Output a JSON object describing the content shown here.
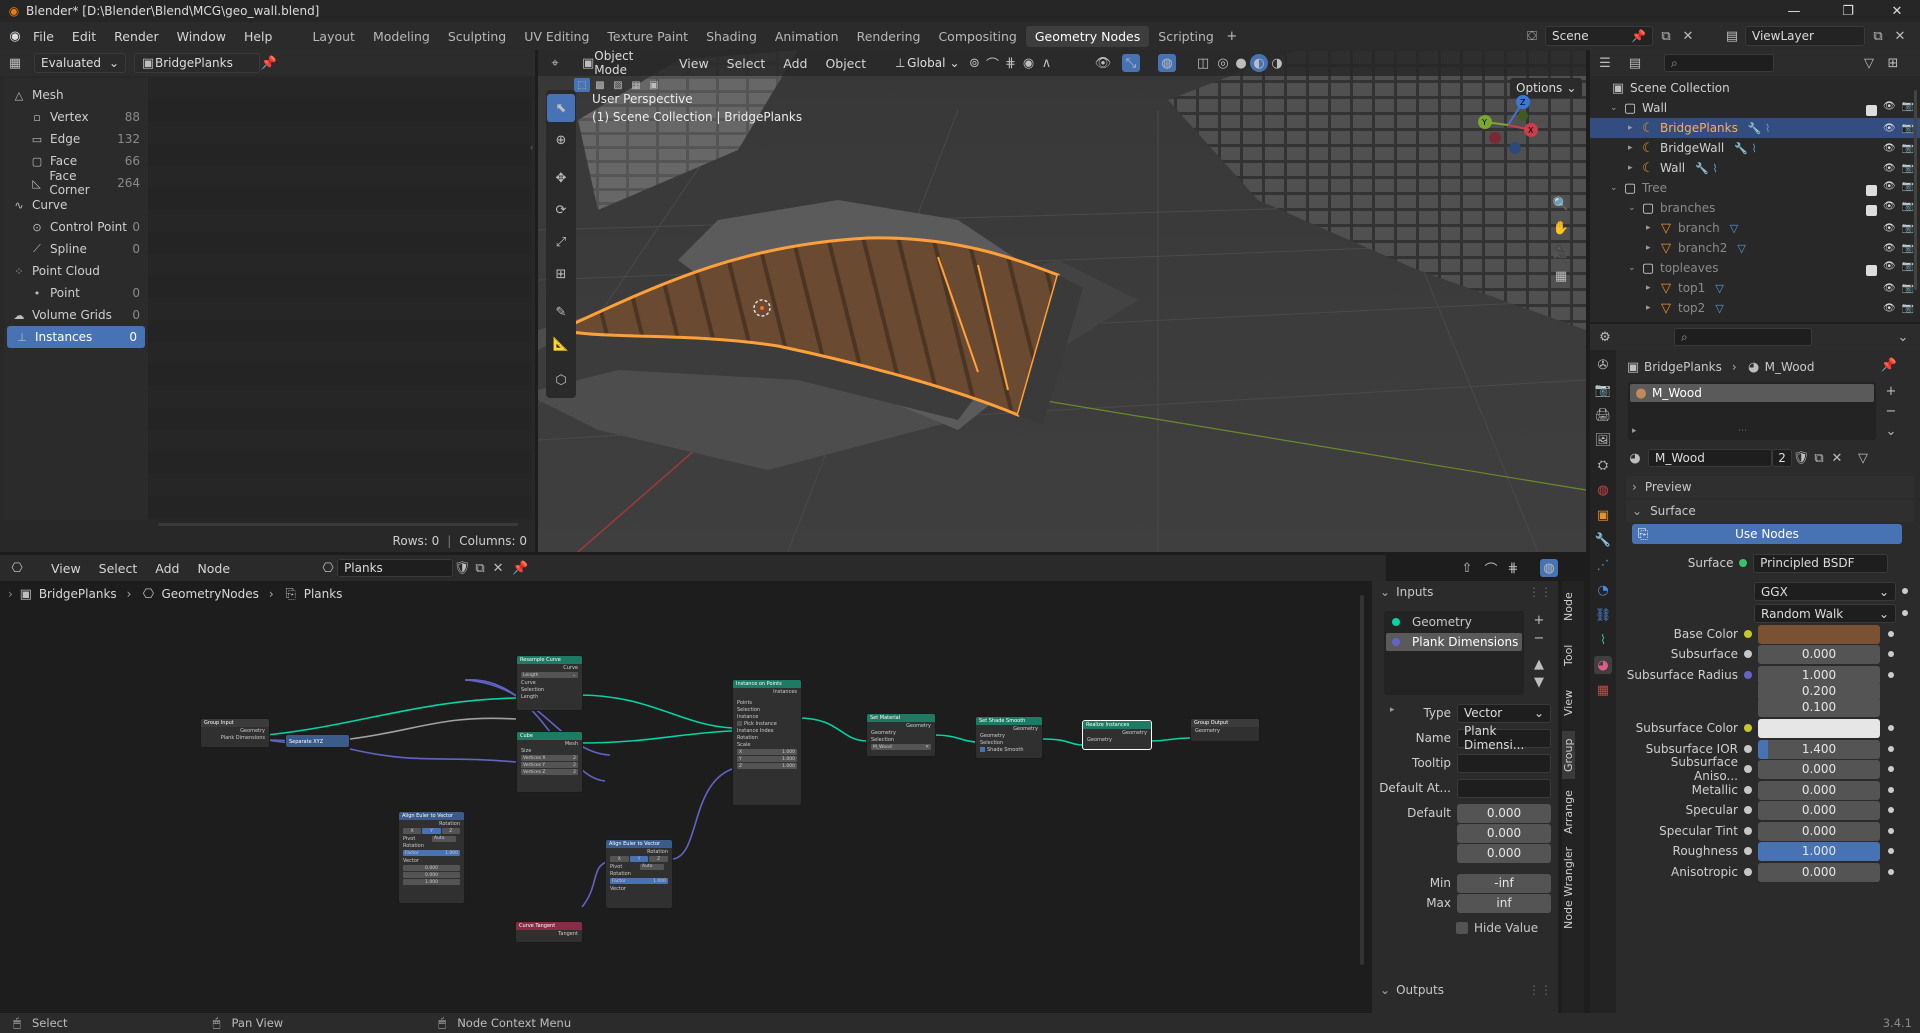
{
  "titlebar": {
    "title": "Blender* [D:\\Blender\\Blend\\MCG\\geo_wall.blend]"
  },
  "menu": [
    "File",
    "Edit",
    "Render",
    "Window",
    "Help"
  ],
  "workspaces": [
    "Layout",
    "Modeling",
    "Sculpting",
    "UV Editing",
    "Texture Paint",
    "Shading",
    "Animation",
    "Rendering",
    "Compositing",
    "Geometry Nodes",
    "Scripting"
  ],
  "active_workspace": "Geometry Nodes",
  "scene": {
    "name": "Scene",
    "view_layer": "ViewLayer"
  },
  "spreadsheet": {
    "mode": "Evaluated",
    "object": "BridgePlanks",
    "rows_label": "Rows: 0",
    "columns_label": "Columns: 0",
    "items": [
      {
        "label": "Mesh",
        "value": "",
        "level": 0
      },
      {
        "label": "Vertex",
        "value": "88",
        "level": 1
      },
      {
        "label": "Edge",
        "value": "132",
        "level": 1
      },
      {
        "label": "Face",
        "value": "66",
        "level": 1
      },
      {
        "label": "Face Corner",
        "value": "264",
        "level": 1
      },
      {
        "label": "Curve",
        "value": "",
        "level": 0
      },
      {
        "label": "Control Point",
        "value": "0",
        "level": 1
      },
      {
        "label": "Spline",
        "value": "0",
        "level": 1
      },
      {
        "label": "Point Cloud",
        "value": "",
        "level": 0
      },
      {
        "label": "Point",
        "value": "0",
        "level": 1
      },
      {
        "label": "Volume Grids",
        "value": "0",
        "level": 0
      },
      {
        "label": "Instances",
        "value": "0",
        "level": 0,
        "active": true
      }
    ]
  },
  "viewport": {
    "mode": "Object Mode",
    "menus": [
      "View",
      "Select",
      "Add",
      "Object"
    ],
    "transform": "Global",
    "options": "Options",
    "perspective": "User Perspective",
    "collection_line": "(1) Scene Collection | BridgePlanks"
  },
  "outliner": {
    "root": "Scene Collection",
    "rows": [
      {
        "label": "Wall",
        "level": 0,
        "type": "collection"
      },
      {
        "label": "BridgePlanks",
        "level": 1,
        "type": "object",
        "selected": true
      },
      {
        "label": "BridgeWall",
        "level": 1,
        "type": "object"
      },
      {
        "label": "Wall",
        "level": 1,
        "type": "object"
      },
      {
        "label": "Tree",
        "level": 0,
        "type": "collection",
        "dim": true
      },
      {
        "label": "branches",
        "level": 1,
        "type": "collection",
        "dim": true
      },
      {
        "label": "branch",
        "level": 2,
        "type": "object",
        "dim": true
      },
      {
        "label": "branch2",
        "level": 2,
        "type": "object",
        "dim": true
      },
      {
        "label": "topleaves",
        "level": 1,
        "type": "collection",
        "dim": true
      },
      {
        "label": "top1",
        "level": 2,
        "type": "object",
        "dim": true
      },
      {
        "label": "top2",
        "level": 2,
        "type": "object",
        "dim": true
      }
    ]
  },
  "properties": {
    "breadcrumb_object": "BridgePlanks",
    "breadcrumb_material": "M_Wood",
    "slot": "M_Wood",
    "material_name": "M_Wood",
    "users": "2",
    "preview_label": "Preview",
    "surface_panel": "Surface",
    "use_nodes": "Use Nodes",
    "surface_label": "Surface",
    "surface_value": "Principled BSDF",
    "distribution": "GGX",
    "subsurface_method": "Random Walk",
    "rows": [
      {
        "label": "Base Color",
        "value": "",
        "kind": "color",
        "color": "#7a5233"
      },
      {
        "label": "Subsurface",
        "value": "0.000"
      },
      {
        "label": "Subsurface Radius",
        "value": "1.000"
      },
      {
        "label": "",
        "value": "0.200"
      },
      {
        "label": "",
        "value": "0.100"
      },
      {
        "label": "Subsurface Color",
        "value": "",
        "kind": "color",
        "color": "#e6e6e6"
      },
      {
        "label": "Subsurface IOR",
        "value": "1.400",
        "kind": "partial",
        "fill": 0.08
      },
      {
        "label": "Subsurface Aniso...",
        "value": "0.000"
      },
      {
        "label": "Metallic",
        "value": "0.000"
      },
      {
        "label": "Specular",
        "value": "0.000"
      },
      {
        "label": "Specular Tint",
        "value": "0.000"
      },
      {
        "label": "Roughness",
        "value": "1.000",
        "kind": "full"
      },
      {
        "label": "Anisotropic",
        "value": "0.000"
      }
    ]
  },
  "node_editor": {
    "menus": [
      "View",
      "Select",
      "Add",
      "Node"
    ],
    "node_group": "Planks",
    "breadcrumb": [
      "BridgePlanks",
      "GeometryNodes",
      "Planks"
    ],
    "side_tabs": [
      "Node",
      "Tool",
      "View",
      "Group",
      "Arrange",
      "Node Wrangler"
    ],
    "inputs_panel": "Inputs",
    "outputs_panel": "Outputs",
    "inputs": [
      "Geometry",
      "Plank Dimensions"
    ],
    "type_label": "Type",
    "type_value": "Vector",
    "name_label": "Name",
    "name_value": "Plank Dimensi...",
    "tooltip_label": "Tooltip",
    "default_at_label": "Default At...",
    "default_label": "Default",
    "default_values": [
      "0.000",
      "0.000",
      "0.000"
    ],
    "min_label": "Min",
    "min_value": "-inf",
    "max_label": "Max",
    "max_value": "inf",
    "hide_value": "Hide Value"
  },
  "nodes": {
    "group_input": {
      "title": "Group Input",
      "out1": "Geometry",
      "out2": "Plank Dimensions"
    },
    "separate_xyz": {
      "title": "Separate XYZ"
    },
    "resample": {
      "title": "Resample Curve",
      "out": "Curve",
      "mode": "Length",
      "in1": "Curve",
      "in2": "Selection",
      "in3": "Length"
    },
    "cube": {
      "title": "Cube",
      "out": "Mesh",
      "in1": "Size",
      "f1": "Vertices X",
      "f2": "Vertices Y",
      "f3": "Vertices Z",
      "v": "2"
    },
    "inst": {
      "title": "Instance on Points",
      "out": "Instances",
      "rows": [
        "Points",
        "Selection",
        "Instance",
        "Pick Instance",
        "Instance Index",
        "Rotation",
        "Scale"
      ],
      "vals": [
        "1.000",
        "1.000",
        "1.000"
      ]
    },
    "setmat": {
      "title": "Set Material",
      "out": "Geometry",
      "in1": "Geometry",
      "in2": "Selection",
      "mat": "M_Wood"
    },
    "shade": {
      "title": "Set Shade Smooth",
      "out": "Geometry",
      "in1": "Geometry",
      "in2": "Selection",
      "in3": "Shade Smooth"
    },
    "realize": {
      "title": "Realize Instances",
      "out": "Geometry",
      "in1": "Geometry"
    },
    "group_output": {
      "title": "Group Output",
      "in1": "Geometry"
    },
    "align1": {
      "title": "Align Euler to Vector",
      "out": "Rotation",
      "x": "X",
      "y": "Y",
      "z": "Z",
      "pivot": "Pivot",
      "auto": "Auto",
      "in1": "Rotation",
      "factor": "Factor",
      "fval": "1.000",
      "vec": "Vector",
      "vals": [
        "0.000",
        "0.000",
        "1.000"
      ]
    },
    "align2": {
      "title": "Align Euler to Vector",
      "out": "Rotation",
      "pivot": "Pivot",
      "auto": "Auto",
      "in1": "Rotation",
      "factor": "Factor",
      "fval": "1.000",
      "vec": "Vector"
    },
    "tangent": {
      "title": "Curve Tangent",
      "out": "Tangent"
    }
  },
  "statusbar": {
    "select": "Select",
    "pan": "Pan View",
    "menu": "Node Context Menu",
    "version": "3.4.1"
  },
  "colors": {
    "accent": "#4772b3",
    "selection": "#ffaa40",
    "geometry_socket": "#00d6a3",
    "vector_socket": "#6363c7",
    "wood": "#7a5233"
  }
}
